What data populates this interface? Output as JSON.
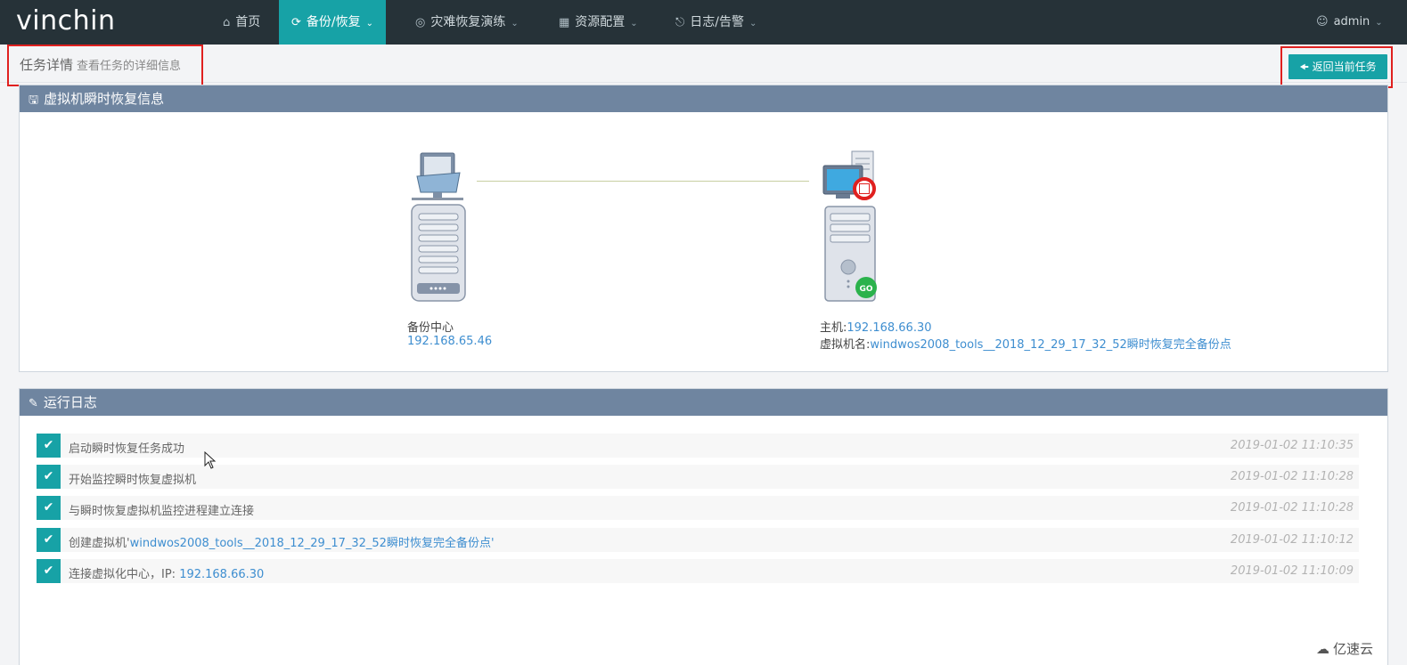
{
  "app": {
    "logo": "vinchin"
  },
  "nav": {
    "items": [
      {
        "icon": "home-icon",
        "label": "首页"
      },
      {
        "icon": "refresh-icon",
        "label": "备份/恢复",
        "active": true
      },
      {
        "icon": "target-icon",
        "label": "灾难恢复演练"
      },
      {
        "icon": "grid-icon",
        "label": "资源配置"
      },
      {
        "icon": "bell-icon",
        "label": "日志/告警"
      }
    ],
    "user": "admin"
  },
  "page": {
    "title": "任务详情",
    "subtitle": "查看任务的详细信息",
    "back_button": "返回当前任务"
  },
  "restore_panel": {
    "title": "虚拟机瞬时恢复信息",
    "source": {
      "name": "备份中心",
      "ip": "192.168.65.46"
    },
    "target": {
      "host_label": "主机:",
      "host_ip": "192.168.66.30",
      "vm_label": "虚拟机名:",
      "vm_name": "windwos2008_tools__2018_12_29_17_32_52瞬时恢复完全备份点"
    }
  },
  "log_panel": {
    "title": "运行日志",
    "entries": [
      {
        "text": "启动瞬时恢复任务成功",
        "link": "",
        "suffix": "",
        "time": "2019-01-02 11:10:35"
      },
      {
        "text": "开始监控瞬时恢复虚拟机",
        "link": "",
        "suffix": "",
        "time": "2019-01-02 11:10:28"
      },
      {
        "text": "与瞬时恢复虚拟机监控进程建立连接",
        "link": "",
        "suffix": "",
        "time": "2019-01-02 11:10:28"
      },
      {
        "text": "创建虚拟机'",
        "link": "windwos2008_tools__2018_12_29_17_32_52瞬时恢复完全备份点",
        "suffix": "'",
        "time": "2019-01-02 11:10:12"
      },
      {
        "text": "连接虚拟化中心，IP: ",
        "link": "192.168.66.30",
        "suffix": "",
        "time": "2019-01-02 11:10:09"
      }
    ]
  },
  "watermark": "亿速云",
  "colors": {
    "accent": "#17a2a6",
    "nav_bg": "#263238",
    "panel_head": "#6f85a0",
    "highlight_box": "#e0201f",
    "link": "#3e8ed0"
  }
}
